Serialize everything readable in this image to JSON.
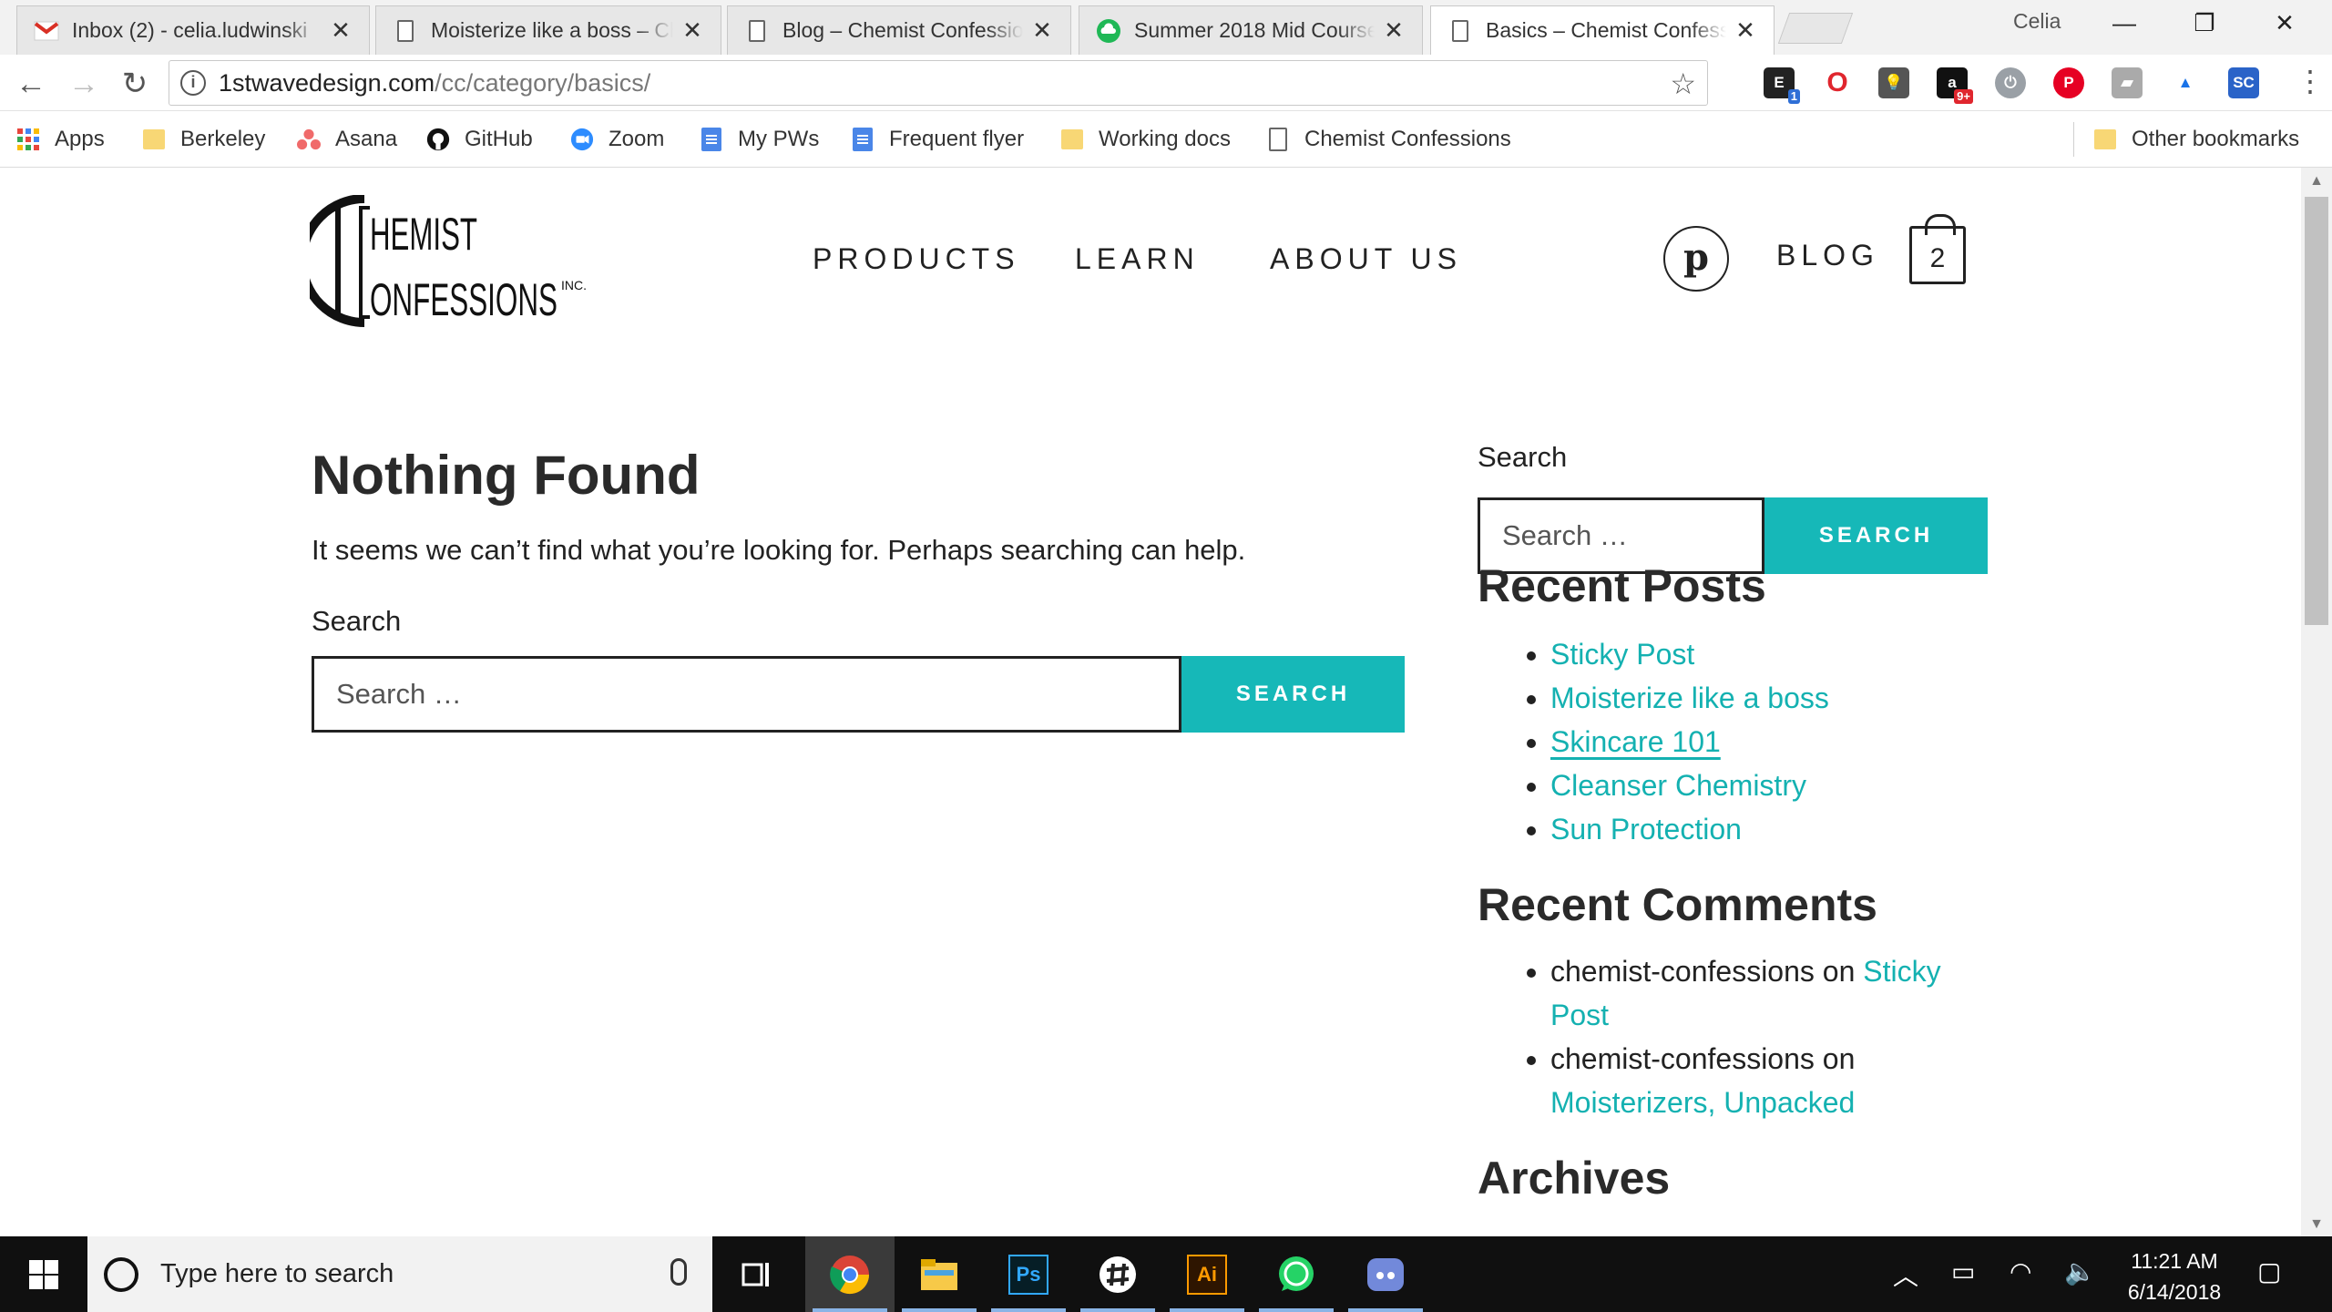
{
  "browser": {
    "tabs": [
      {
        "title": "Inbox (2) - celia.ludwinski",
        "icon": "gmail-icon",
        "active": false
      },
      {
        "title": "Moisterize like a boss – Chemist",
        "icon": "page-icon",
        "active": false
      },
      {
        "title": "Blog – Chemist Confessions",
        "icon": "page-icon",
        "active": false
      },
      {
        "title": "Summer 2018 Mid Course",
        "icon": "cloud-icon",
        "active": false
      },
      {
        "title": "Basics – Chemist Confessions",
        "icon": "page-icon",
        "active": true
      }
    ],
    "profile_name": "Celia",
    "url_domain": "1stwavedesign.com",
    "url_path": "/cc/category/basics/",
    "extension_badges": {
      "ext1": "1",
      "amazon": "9+"
    }
  },
  "bookmarks": [
    {
      "label": "Apps",
      "icon": "apps-grid-icon"
    },
    {
      "label": "Berkeley",
      "icon": "folder-icon"
    },
    {
      "label": "Asana",
      "icon": "asana-icon"
    },
    {
      "label": "GitHub",
      "icon": "github-icon"
    },
    {
      "label": "Zoom",
      "icon": "zoom-icon"
    },
    {
      "label": "My PWs",
      "icon": "google-doc-icon"
    },
    {
      "label": "Frequent flyer",
      "icon": "google-doc-icon"
    },
    {
      "label": "Working docs",
      "icon": "folder-icon"
    },
    {
      "label": "Chemist Confessions",
      "icon": "page-icon"
    },
    {
      "label": "Other bookmarks",
      "icon": "folder-icon"
    }
  ],
  "site": {
    "logo": {
      "line1": "HEMIST",
      "line2": "ONFESSIONS",
      "suffix": "INC."
    },
    "nav": [
      "PRODUCTS",
      "LEARN",
      "ABOUT US"
    ],
    "blog_label": "BLOG",
    "pinterest_glyph": "p",
    "cart_count": "2",
    "accent_color": "#16b8b8"
  },
  "main": {
    "title": "Nothing Found",
    "message": "It seems we can’t find what you’re looking for. Perhaps searching can help.",
    "search_label": "Search",
    "search_placeholder": "Search …",
    "search_button": "SEARCH"
  },
  "sidebar": {
    "search_label": "Search",
    "search_placeholder": "Search …",
    "search_button": "SEARCH",
    "recent_posts_title": "Recent Posts",
    "recent_posts": [
      "Sticky Post",
      "Moisterize like a boss",
      "Skincare 101",
      "Cleanser Chemistry",
      "Sun Protection"
    ],
    "recent_comments_title": "Recent Comments",
    "recent_comments": [
      {
        "author": "chemist-confessions",
        "on": "on",
        "post": "Sticky Post"
      },
      {
        "author": "chemist-confessions",
        "on": "on",
        "post": "Moisterizers, Unpacked"
      }
    ],
    "archives_title": "Archives"
  },
  "taskbar": {
    "search_text": "Type here to search",
    "apps": [
      "chrome-icon",
      "file-explorer-icon",
      "photoshop-icon",
      "slack-icon",
      "illustrator-icon",
      "whatsapp-icon",
      "discord-icon"
    ],
    "ps_label": "Ps",
    "ai_label": "Ai",
    "time": "11:21 AM",
    "date": "6/14/2018"
  }
}
